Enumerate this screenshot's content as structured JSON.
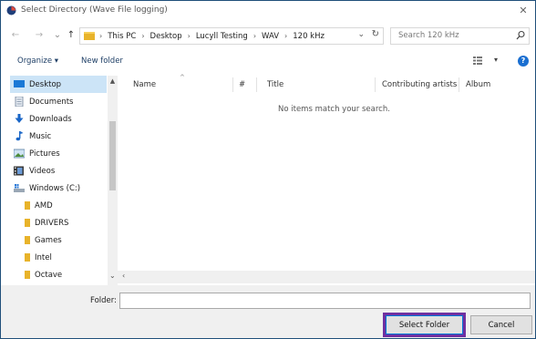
{
  "window": {
    "title": "Select Directory (Wave File logging)",
    "close_glyph": "✕"
  },
  "nav": {
    "back_glyph": "←",
    "forward_glyph": "→",
    "history_glyph": "⌄",
    "up_glyph": "↑",
    "breadcrumbs": [
      "This PC",
      "Desktop",
      "Lucyll Testing",
      "WAV",
      "120 kHz"
    ],
    "breadcrumb_sep": "›",
    "dropdown_glyph": "⌄",
    "refresh_glyph": "↻",
    "search_placeholder": "Search 120 kHz"
  },
  "toolbar": {
    "organize": "Organize ▾",
    "new_folder": "New folder",
    "view_dropdown": "▾",
    "help": "?"
  },
  "sidebar": {
    "items": [
      {
        "label": "Desktop",
        "icon": "desktop-icon",
        "selected": true
      },
      {
        "label": "Documents",
        "icon": "documents-icon"
      },
      {
        "label": "Downloads",
        "icon": "downloads-icon"
      },
      {
        "label": "Music",
        "icon": "music-icon"
      },
      {
        "label": "Pictures",
        "icon": "pictures-icon"
      },
      {
        "label": "Videos",
        "icon": "videos-icon"
      },
      {
        "label": "Windows (C:)",
        "icon": "drive-icon"
      },
      {
        "label": "AMD",
        "icon": "folder-icon",
        "sub": true
      },
      {
        "label": "DRIVERS",
        "icon": "folder-icon",
        "sub": true
      },
      {
        "label": "Games",
        "icon": "folder-icon",
        "sub": true
      },
      {
        "label": "Intel",
        "icon": "folder-icon",
        "sub": true
      },
      {
        "label": "Octave",
        "icon": "folder-icon",
        "sub": true
      }
    ]
  },
  "list": {
    "columns": [
      "Name",
      "#",
      "Title",
      "Contributing artists",
      "Album"
    ],
    "empty_message": "No items match your search."
  },
  "footer": {
    "folder_label": "Folder:",
    "folder_value": "",
    "select_button": "Select Folder",
    "cancel_button": "Cancel"
  },
  "colors": {
    "accent": "#0078d7",
    "highlight_outline": "#7030a0",
    "selected_bg": "#cce4f7",
    "window_border": "#1f4f7a"
  }
}
